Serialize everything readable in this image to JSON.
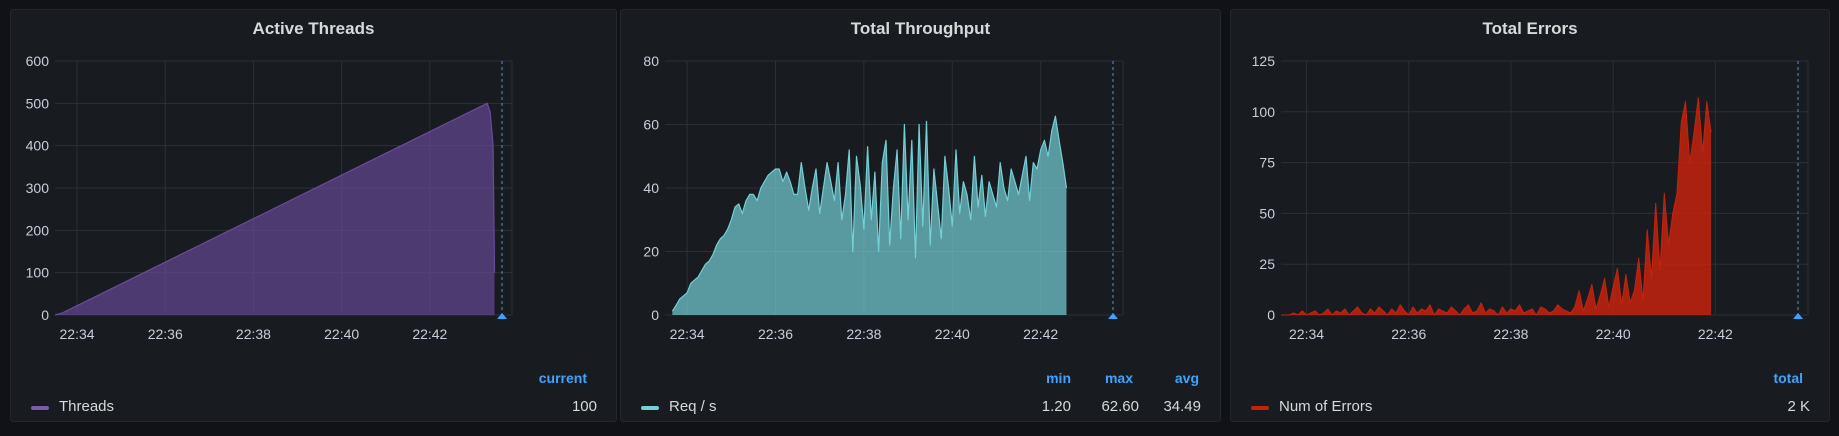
{
  "panels": [
    {
      "title": "Active Threads",
      "legend": {
        "headers": [
          "current"
        ],
        "series_name": "Threads",
        "values": [
          "100"
        ],
        "color": "#7b5aad"
      }
    },
    {
      "title": "Total Throughput",
      "legend": {
        "headers": [
          "min",
          "max",
          "avg"
        ],
        "series_name": "Req / s",
        "values": [
          "1.20",
          "62.60",
          "34.49"
        ],
        "color": "#73d0d6"
      }
    },
    {
      "title": "Total Errors",
      "legend": {
        "headers": [
          "total"
        ],
        "series_name": "Num of Errors",
        "values": [
          "2 K"
        ],
        "color": "#c4230d"
      }
    }
  ],
  "chart_data": [
    {
      "type": "area",
      "title": "Active Threads",
      "x_ticks": [
        "22:34",
        "22:36",
        "22:38",
        "22:40",
        "22:42"
      ],
      "x_range": [
        "22:33:30",
        "22:43:30"
      ],
      "ylim": [
        0,
        600
      ],
      "y_ticks": [
        0,
        100,
        200,
        300,
        400,
        500,
        600
      ],
      "grid": true,
      "legend_placement": "bottom",
      "series": [
        {
          "name": "Threads",
          "color": "#6a4c9c",
          "x": [
            "22:33:30",
            "22:33:40",
            "22:43:18",
            "22:43:22",
            "22:43:26",
            "22:43:28"
          ],
          "values": [
            0,
            5,
            500,
            480,
            400,
            100
          ]
        }
      ]
    },
    {
      "type": "area",
      "title": "Total Throughput",
      "x_ticks": [
        "22:34",
        "22:36",
        "22:38",
        "22:40",
        "22:42"
      ],
      "x_range": [
        "22:33:30",
        "22:43:30"
      ],
      "ylim": [
        0,
        80
      ],
      "y_ticks": [
        0,
        20,
        40,
        60,
        80
      ],
      "grid": true,
      "legend_placement": "bottom",
      "series": [
        {
          "name": "Req / s",
          "color": "#73d0d6",
          "x_start": "22:33:40",
          "x_step_seconds": 5,
          "values": [
            1.2,
            3,
            5,
            6,
            7,
            10,
            11,
            12,
            14,
            16,
            17,
            19,
            22,
            24,
            25,
            27,
            30,
            34,
            35,
            32,
            36,
            38,
            38,
            36,
            40,
            42,
            44,
            45,
            46,
            46,
            42,
            45,
            42,
            38,
            38,
            48,
            40,
            33,
            40,
            46,
            32,
            40,
            48,
            42,
            36,
            48,
            30,
            38,
            52,
            20,
            50,
            41,
            27,
            53,
            30,
            45,
            20,
            48,
            55,
            22,
            40,
            52,
            24,
            60,
            30,
            55,
            18,
            60,
            28,
            61,
            22,
            46,
            35,
            24,
            50,
            40,
            28,
            52,
            32,
            42,
            38,
            30,
            50,
            34,
            44,
            31,
            42,
            38,
            34,
            48,
            40,
            36,
            46,
            42,
            38,
            44,
            50,
            36,
            48,
            46,
            52,
            55,
            50,
            58,
            62.6,
            55,
            48,
            40
          ]
        }
      ]
    },
    {
      "type": "area",
      "title": "Total Errors",
      "x_ticks": [
        "22:34",
        "22:36",
        "22:38",
        "22:40",
        "22:42"
      ],
      "x_range": [
        "22:33:30",
        "22:43:30"
      ],
      "ylim": [
        0,
        125
      ],
      "y_ticks": [
        0,
        25,
        50,
        75,
        100,
        125
      ],
      "grid": true,
      "legend_placement": "bottom",
      "series": [
        {
          "name": "Num of Errors",
          "color": "#c4230d",
          "x_start": "22:33:30",
          "x_step_seconds": 5,
          "values": [
            0,
            0,
            0,
            1,
            0,
            2,
            0,
            1,
            2,
            0,
            1,
            3,
            0,
            2,
            1,
            3,
            0,
            2,
            4,
            1,
            0,
            3,
            1,
            4,
            2,
            0,
            3,
            1,
            5,
            2,
            0,
            4,
            1,
            3,
            2,
            5,
            0,
            3,
            2,
            1,
            4,
            2,
            0,
            3,
            5,
            1,
            2,
            6,
            1,
            3,
            2,
            0,
            4,
            1,
            3,
            2,
            5,
            1,
            2,
            3,
            0,
            4,
            3,
            1,
            2,
            5,
            3,
            2,
            1,
            4,
            12,
            2,
            8,
            15,
            3,
            10,
            18,
            4,
            14,
            23,
            5,
            20,
            6,
            12,
            28,
            7,
            42,
            18,
            55,
            22,
            60,
            35,
            50,
            60,
            95,
            105,
            75,
            90,
            107,
            80,
            105,
            90
          ]
        }
      ]
    }
  ]
}
